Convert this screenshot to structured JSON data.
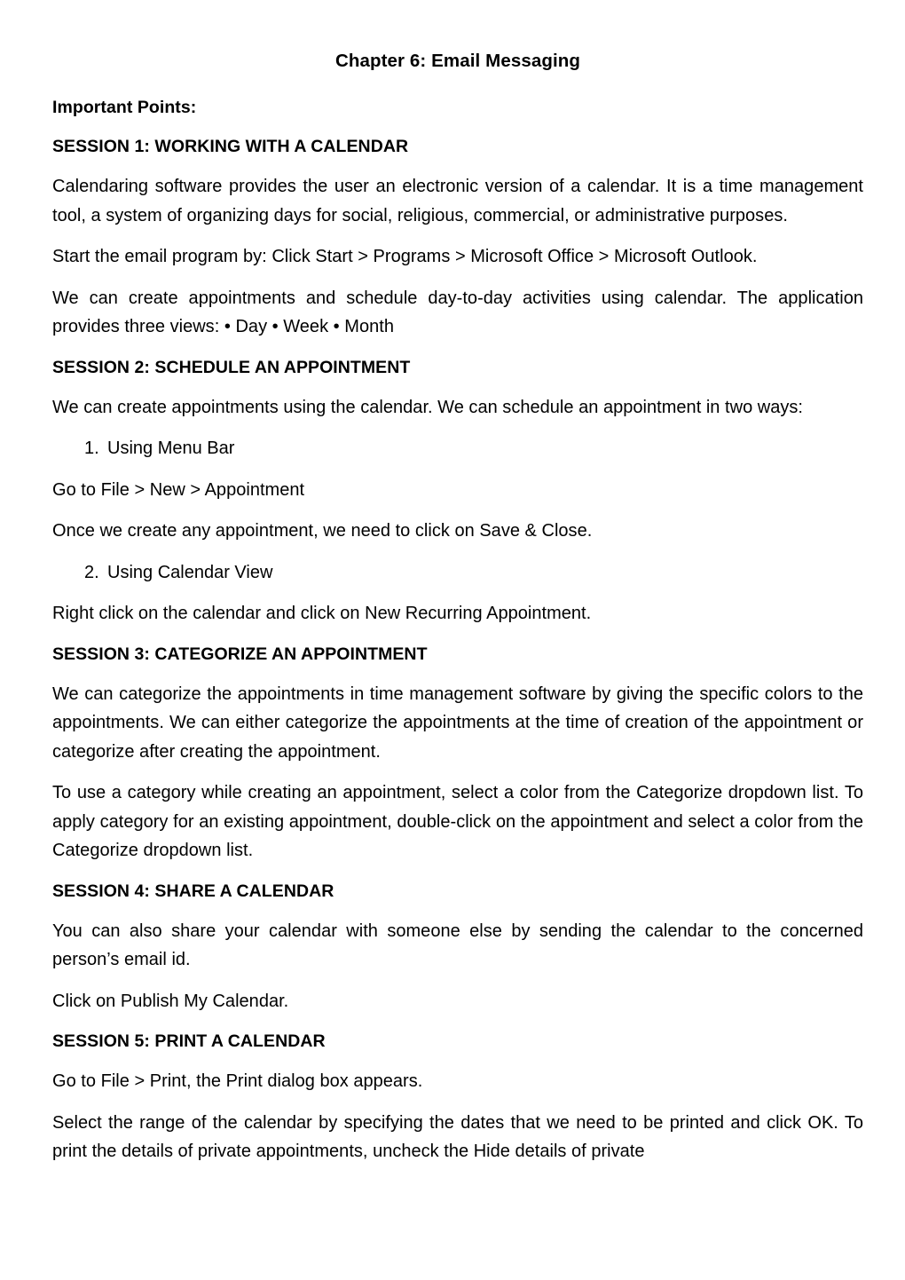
{
  "document": {
    "title": "Chapter 6: Email Messaging",
    "intro_heading": "Important Points:",
    "sections": [
      {
        "heading": "SESSION 1: WORKING WITH A CALENDAR",
        "paragraphs": [
          "Calendaring software provides the user an electronic version of a calendar. It is a time management tool, a system of organizing days for social, religious, commercial, or administrative purposes.",
          "Start the email program by: Click Start > Programs > Microsoft Office > Microsoft Outlook.",
          "We can create appointments and schedule day-to-day activities using calendar. The application provides three views: • Day • Week • Month"
        ]
      },
      {
        "heading": "SESSION 2: SCHEDULE AN APPOINTMENT",
        "paragraphs": [
          "We can create appointments using the calendar. We can schedule an appointment in two ways:"
        ],
        "list_item_1_number": "1.",
        "list_item_1_text": "Using Menu Bar",
        "after_item_1_a": "Go to File > New > Appointment",
        "after_item_1_b": "Once we create any appointment, we need to click on Save & Close.",
        "list_item_2_number": "2.",
        "list_item_2_text": "Using Calendar View",
        "after_item_2": "Right click on the calendar and click on New Recurring Appointment."
      },
      {
        "heading": "SESSION 3: CATEGORIZE AN APPOINTMENT",
        "paragraphs": [
          "We can categorize the appointments in time management software by giving the specific colors to the appointments. We can either categorize the appointments at the time of creation of the appointment or categorize after creating the appointment.",
          "To use a category while creating an appointment, select a color from the Categorize dropdown list. To apply category for an existing appointment, double-click on the appointment and select a color from the Categorize dropdown list."
        ]
      },
      {
        "heading": "SESSION 4: SHARE A CALENDAR",
        "paragraphs": [
          "You can also share your calendar with someone else by sending the calendar to the concerned person’s email id.",
          "Click on Publish My Calendar."
        ]
      },
      {
        "heading": "SESSION 5: PRINT A CALENDAR",
        "paragraphs": [
          "Go to File > Print, the Print dialog box appears.",
          "Select the range of the calendar by specifying the dates that we need to be printed and click OK. To print the details of private appointments, uncheck the Hide details of private"
        ]
      }
    ]
  }
}
